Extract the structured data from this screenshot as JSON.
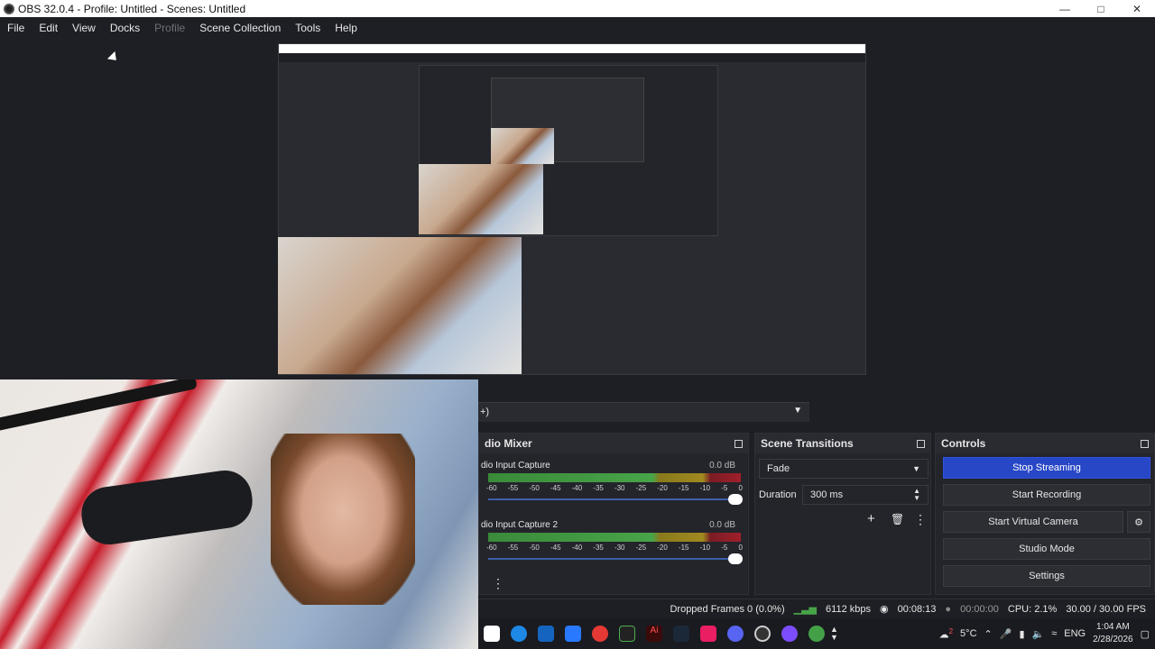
{
  "window": {
    "title": "OBS 32.0.4 - Profile: Untitled - Scenes: Untitled"
  },
  "menu": [
    "File",
    "Edit",
    "View",
    "Docks",
    "Profile",
    "Scene Collection",
    "Tools",
    "Help"
  ],
  "audio_mixer": {
    "title": "dio Mixer",
    "channels": [
      {
        "name": "dio Input Capture",
        "db": "0.0 dB",
        "level": 0.84
      },
      {
        "name": "dio Input Capture 2",
        "db": "0.0 dB",
        "level": 0.82
      }
    ],
    "ticks": [
      "-60",
      "-55",
      "-50",
      "-45",
      "-40",
      "-35",
      "-30",
      "-25",
      "-20",
      "-15",
      "-10",
      "-5",
      "0"
    ]
  },
  "scene_transitions": {
    "title": "Scene Transitions",
    "transition": "Fade",
    "duration_label": "Duration",
    "duration_value": "300 ms"
  },
  "controls": {
    "title": "Controls",
    "stop_streaming": "Stop Streaming",
    "start_recording": "Start Recording",
    "start_virtual_camera": "Start Virtual Camera",
    "studio_mode": "Studio Mode",
    "settings": "Settings"
  },
  "scenes_strip": {
    "text": "+)"
  },
  "status": {
    "dropped_frames": "Dropped Frames 0 (0.0%)",
    "bitrate": "6112 kbps",
    "stream_time": "00:08:13",
    "record_time": "00:00:00",
    "cpu": "CPU: 2.1%",
    "fps": "30.00 / 30.00 FPS"
  },
  "taskbar": {
    "weather": "5°C",
    "lang": "ENG",
    "time": "1:04 AM",
    "date": "2/28/2026",
    "badge": "2"
  },
  "colors": {
    "accent": "#2747c6",
    "panel": "#24252b",
    "bg": "#1e1f24"
  }
}
